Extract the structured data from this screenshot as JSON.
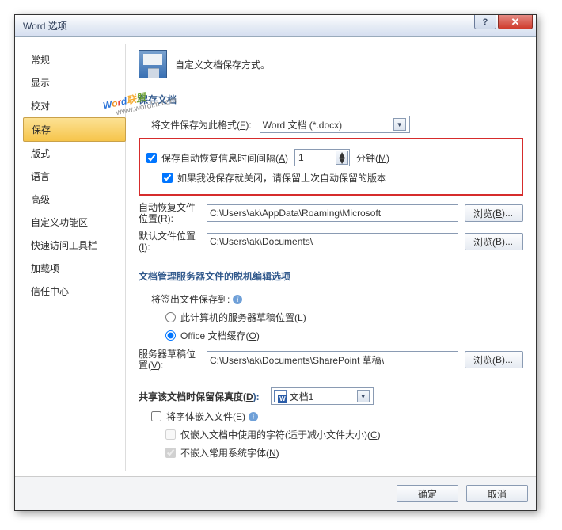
{
  "title": "Word 选项",
  "header_desc": "自定义文档保存方式。",
  "nav": [
    "常规",
    "显示",
    "校对",
    "保存",
    "版式",
    "语言",
    "高级",
    "自定义功能区",
    "快速访问工具栏",
    "加载项",
    "信任中心"
  ],
  "nav_selected": 3,
  "section_save_docs": "保存文档",
  "format_label_pre": "将文件保存为此格式(",
  "format_label_key": "F",
  "format_value": "Word 文档 (*.docx)",
  "autorecover": {
    "chk_label_pre": "保存自动恢复信息时间间隔(",
    "chk_label_key": "A",
    "value": "1",
    "minutes_pre": "分钟(",
    "minutes_key": "M",
    "sub_chk": "如果我没保存就关闭，请保留上次自动保留的版本"
  },
  "paths": {
    "autorecover_lbl_pre": "自动恢复文件位置(",
    "autorecover_lbl_key": "R",
    "autorecover_val": "C:\\Users\\ak\\AppData\\Roaming\\Microsoft",
    "default_lbl_pre": "默认文件位置(",
    "default_lbl_key": "I",
    "default_val": "C:\\Users\\ak\\Documents\\",
    "browse_pre": "浏览(",
    "browse_key": "B",
    "browse_suf": ")..."
  },
  "offline_section": "文档管理服务器文件的脱机编辑选项",
  "checkout": {
    "label": "将签出文件保存到:",
    "opt1_pre": "此计算机的服务器草稿位置(",
    "opt1_key": "L",
    "opt2_pre": "Office 文档缓存(",
    "opt2_key": "O"
  },
  "server_draft": {
    "lbl_pre": "服务器草稿位置(",
    "lbl_key": "V",
    "val": "C:\\Users\\ak\\Documents\\SharePoint 草稿\\"
  },
  "fidelity": {
    "label_pre": "共享该文档时保留保真度(",
    "label_key": "D",
    "doc_name": "文档1",
    "embed_pre": "将字体嵌入文件(",
    "embed_key": "E",
    "only_used_pre": "仅嵌入文档中使用的字符(适于减小文件大小)(",
    "only_used_key": "C",
    "no_common_pre": "不嵌入常用系统字体(",
    "no_common_key": "N"
  },
  "buttons": {
    "ok": "确定",
    "cancel": "取消"
  },
  "watermark": {
    "text": "Word联盟",
    "sub": "www.wordlm.com"
  }
}
